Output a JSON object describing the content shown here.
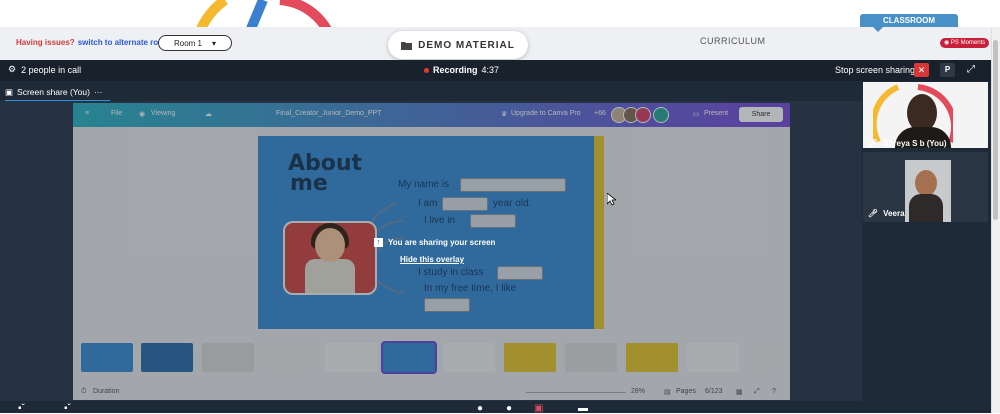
{
  "top": {
    "issues_text": "Having issues?",
    "switch_link": "switch to alternate room",
    "room_select": "Room 1",
    "demo_tab": "DEMO MATERIAL",
    "curriculum_tab": "CURRICULUM",
    "classroom_tab": "CLASSROOM",
    "ps_moments": "PS Moments"
  },
  "meeting": {
    "people_count": "2 people in call",
    "recording_label": "Recording",
    "recording_time": "4:37",
    "stop_share": "Stop screen sharing",
    "close_symbol": "✕",
    "p_button": "P",
    "share_tab": "Screen share (You)",
    "share_tab_more": "···",
    "overlay_message": "You are sharing your screen",
    "overlay_hide": "Hide this overlay"
  },
  "canva": {
    "menu_file": "File",
    "menu_viewing": "Viewing",
    "doc_title": "Final_Creator_Junior_Demo_PPT",
    "upgrade": "Upgrade to Canva Pro",
    "collab_count": "+66",
    "present": "Present",
    "share": "Share",
    "duration": "Duration",
    "zoom": "28%",
    "pages_label": "Pages",
    "page_counter": "6/123",
    "slide": {
      "title_line1": "About",
      "title_line2": "me",
      "line_name": "My name is",
      "line_age_a": "I am",
      "line_age_b": "year old.",
      "line_live": "I live in",
      "line_study": "I study in class",
      "line_free": "In my free time, I like"
    }
  },
  "participants": [
    {
      "name": "Shreya S b (You)"
    },
    {
      "name": "Veera"
    }
  ],
  "colors": {
    "meeting_bg": "#1f2a38",
    "accent_blue": "#2f8fd9",
    "danger_red": "#d93636",
    "slide_blue": "#3d8ed6"
  }
}
